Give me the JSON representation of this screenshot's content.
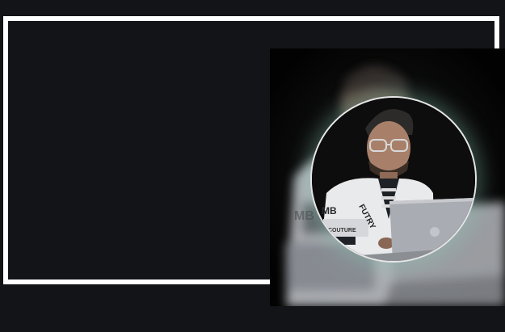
{
  "page": {
    "background": "#131418",
    "frame_color": "#ffffff"
  },
  "photo": {
    "description_icon": "person-with-laptop-photo",
    "shirt_text_1": "FUTRY",
    "shirt_text_2": "MB",
    "shirt_text_3": "COUTURE"
  },
  "avatar": {
    "ring_color": "#e6e6e6",
    "glow_color": "#8cd2be"
  }
}
